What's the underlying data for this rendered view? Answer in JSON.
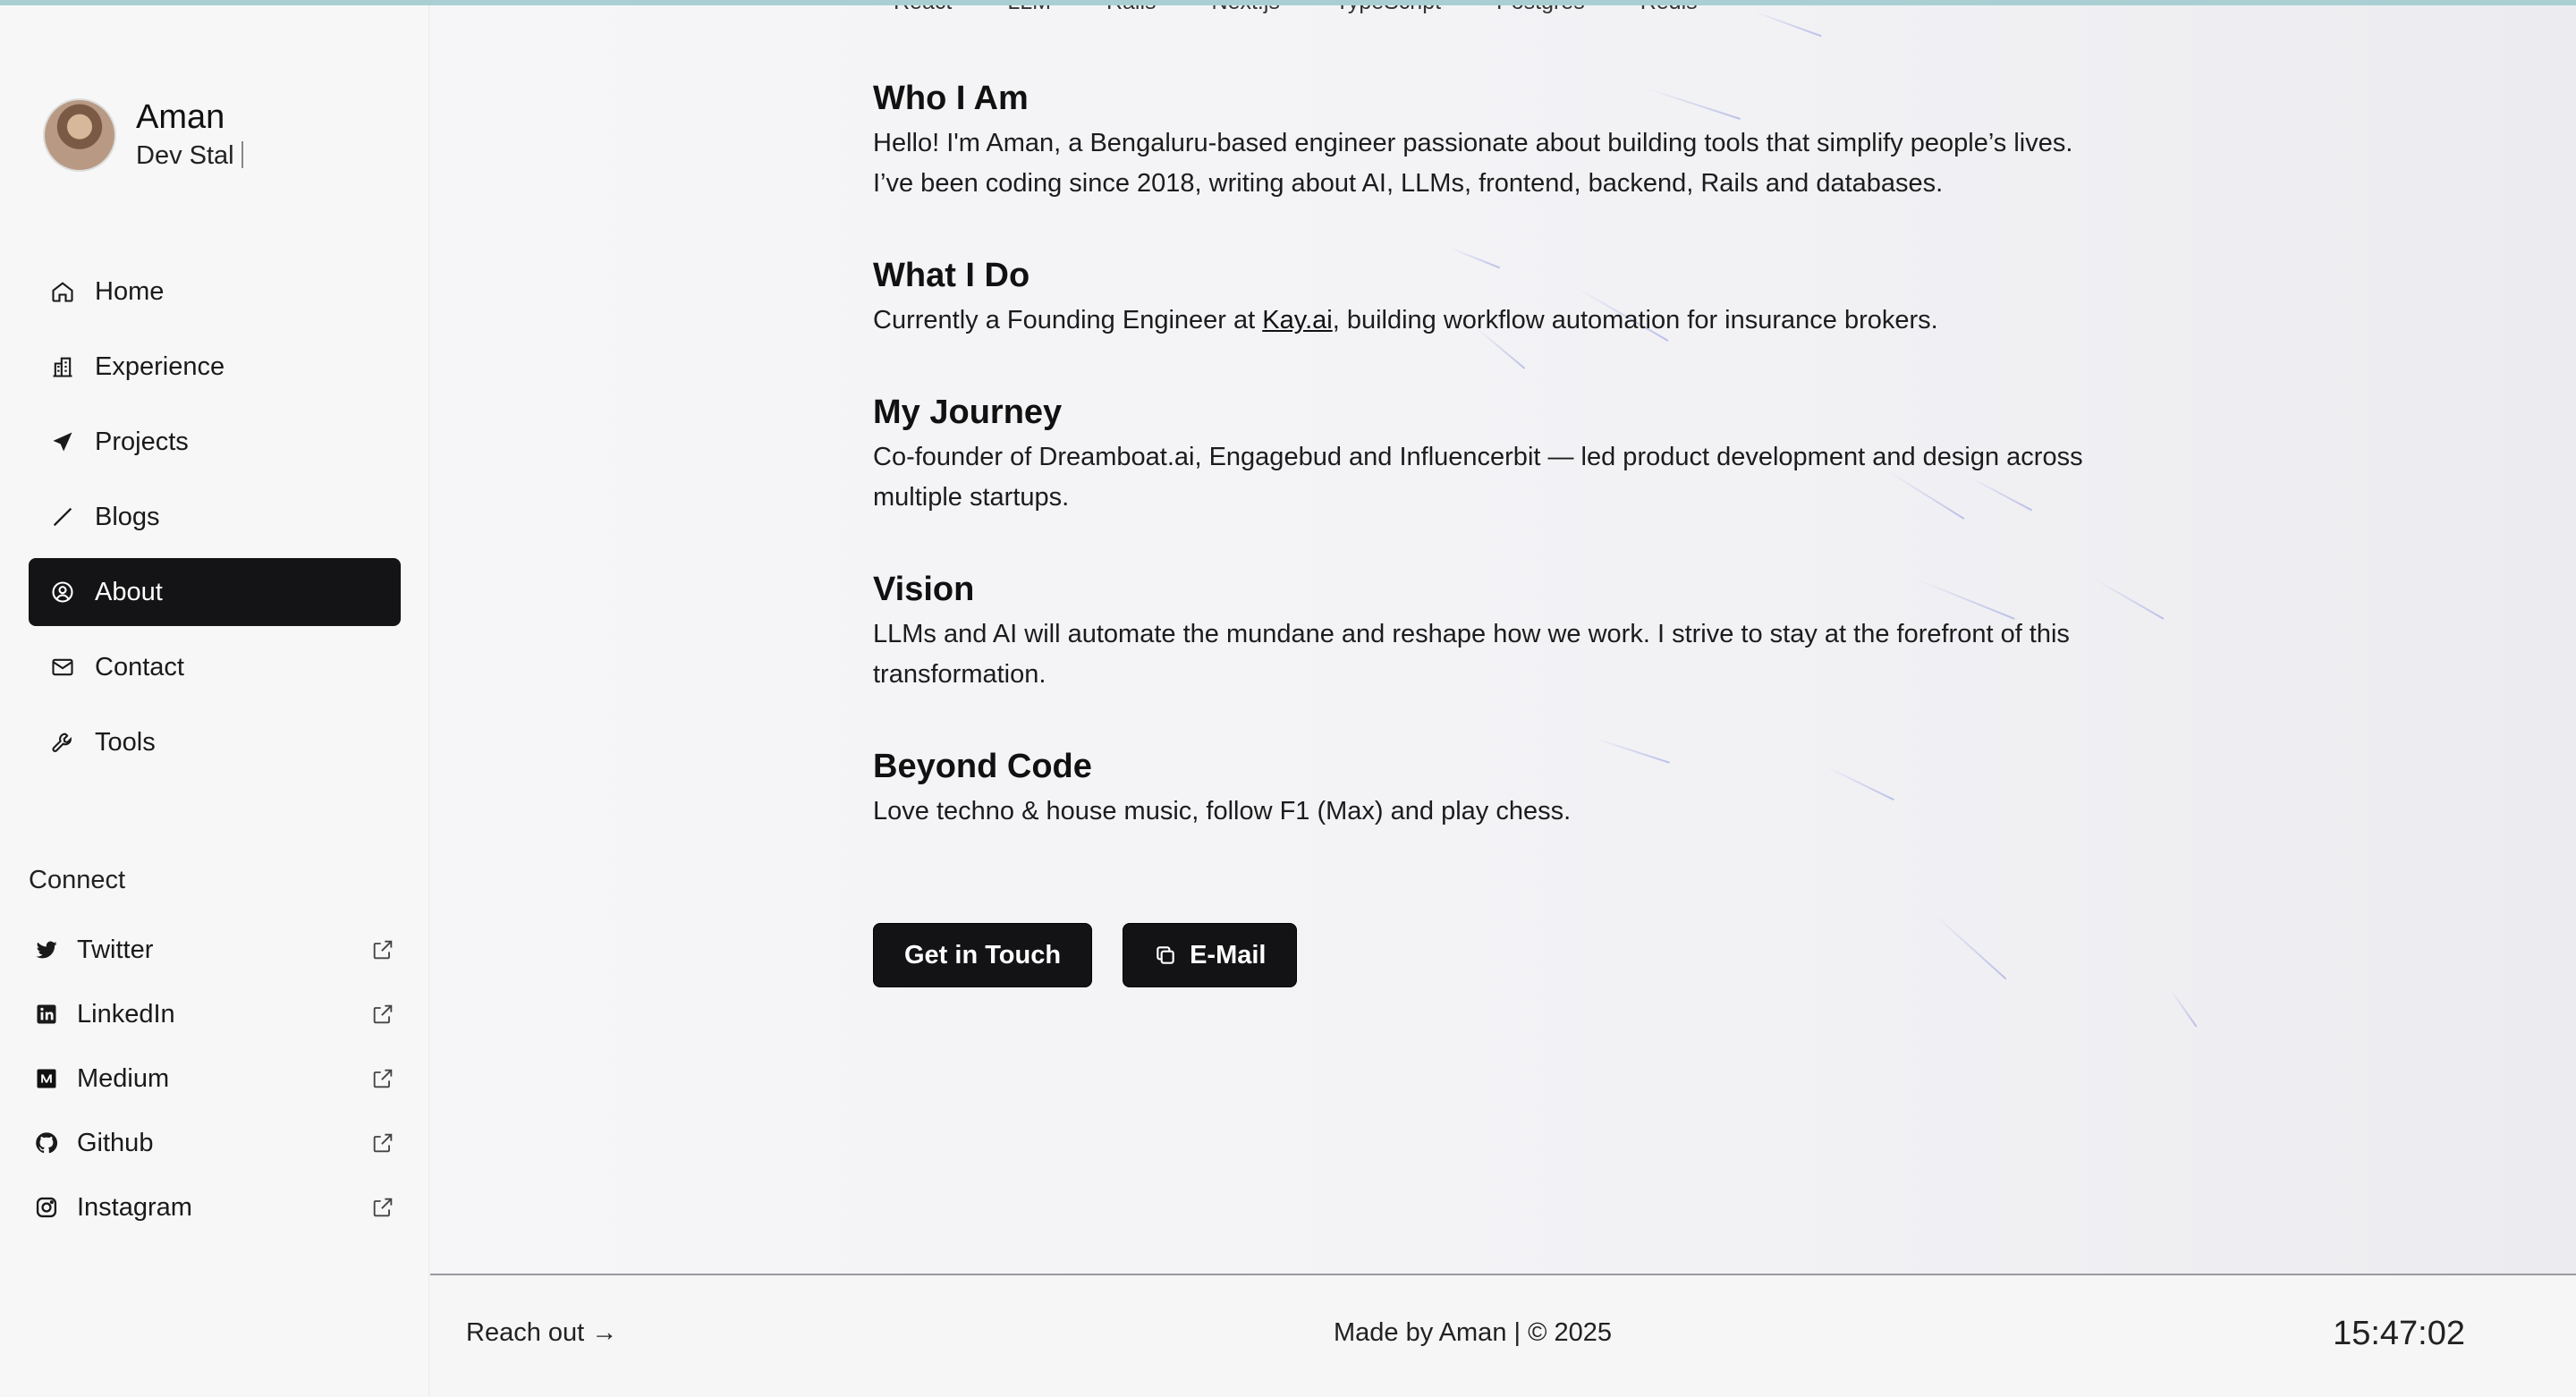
{
  "profile": {
    "name": "Aman",
    "subtitle": "Dev Stal"
  },
  "nav": {
    "items": [
      {
        "label": "Home",
        "icon": "home-icon",
        "active": false
      },
      {
        "label": "Experience",
        "icon": "building-icon",
        "active": false
      },
      {
        "label": "Projects",
        "icon": "send-icon",
        "active": false
      },
      {
        "label": "Blogs",
        "icon": "pencil-icon",
        "active": false
      },
      {
        "label": "About",
        "icon": "user-circle-icon",
        "active": true
      },
      {
        "label": "Contact",
        "icon": "mail-icon",
        "active": false
      },
      {
        "label": "Tools",
        "icon": "wrench-icon",
        "active": false
      }
    ]
  },
  "connect": {
    "title": "Connect",
    "items": [
      {
        "label": "Twitter",
        "icon": "twitter-icon"
      },
      {
        "label": "LinkedIn",
        "icon": "linkedin-icon"
      },
      {
        "label": "Medium",
        "icon": "medium-icon"
      },
      {
        "label": "Github",
        "icon": "github-icon"
      },
      {
        "label": "Instagram",
        "icon": "instagram-icon"
      }
    ]
  },
  "chips": [
    "React",
    "LLM",
    "Rails",
    "Next.js",
    "TypeScript",
    "Postgres",
    "Redis"
  ],
  "sections": {
    "who": {
      "title": "Who I Am",
      "line1": "Hello! I'm Aman, a Bengaluru-based engineer passionate about building tools that simplify people’s lives.",
      "line2": "I’ve been coding since 2018, writing about AI, LLMs, frontend, backend, Rails and databases."
    },
    "what": {
      "title": "What I Do",
      "before": "Currently a Founding Engineer at ",
      "link": "Kay.ai",
      "after": ", building workflow automation for insurance brokers."
    },
    "journey": {
      "title": "My Journey",
      "line1": "Co-founder of Dreamboat.ai, Engagebud and Influencerbit — led product development and design across",
      "line2": "multiple startups."
    },
    "vision": {
      "title": "Vision",
      "line1": "LLMs and AI will automate the mundane and reshape how we work. I strive to stay at the forefront of this",
      "line2": "transformation."
    },
    "beyond": {
      "title": "Beyond Code",
      "line1": "Love techno & house music, follow F1 (Max) and play chess."
    }
  },
  "buttons": {
    "get_in_touch": "Get in Touch",
    "email": "E-Mail"
  },
  "footer": {
    "reach_out": "Reach out →",
    "made_by": "Made by Aman | © 2025",
    "clock": "15:47:02"
  },
  "colors": {
    "active_nav_bg": "#141416",
    "button_bg": "#131315",
    "top_accent": "#a9cfd3"
  }
}
